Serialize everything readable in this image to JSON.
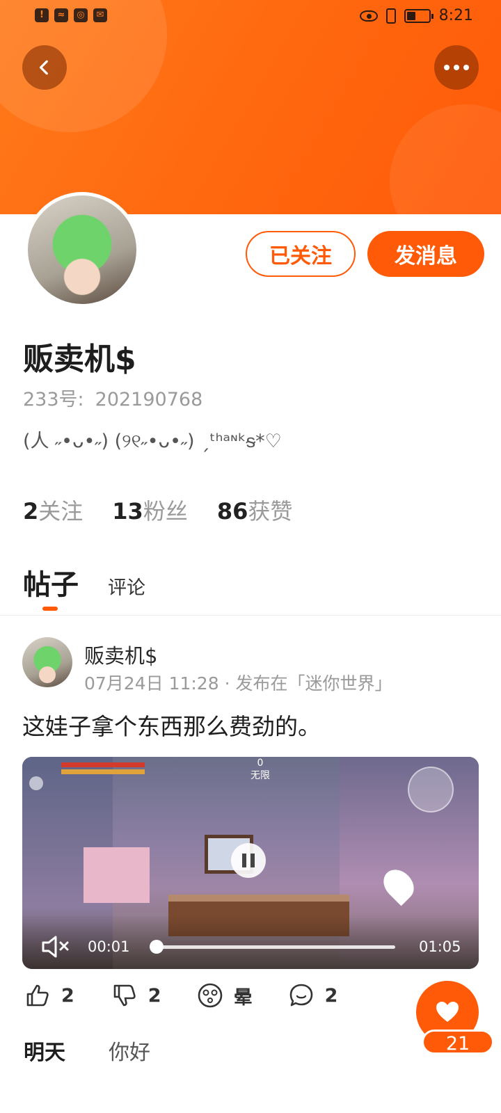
{
  "status_bar": {
    "time": "8:21",
    "icons": [
      "alert-icon",
      "wifi-icon",
      "globe-icon",
      "sms-icon",
      "eye-icon",
      "vibrate-icon",
      "battery-icon"
    ]
  },
  "profile": {
    "name": "贩卖机$",
    "id_label": "233号:",
    "id_value": "202190768",
    "bio": "(人 ˶•ᴗ•˶) (୨୧˶•ᴗ•˶) ˏᵗʰᵃᶰᵏᵴ*♡",
    "follow_state_label": "已关注",
    "message_label": "发消息"
  },
  "stats": [
    {
      "value": "2",
      "label": "关注"
    },
    {
      "value": "13",
      "label": "粉丝"
    },
    {
      "value": "86",
      "label": "获赞"
    }
  ],
  "tabs": {
    "posts": "帖子",
    "comments": "评论"
  },
  "post": {
    "author": "贩卖机$",
    "meta": "07月24日 11:28 · 发布在「迷你世界」",
    "text": "这娃子拿个东西那么费劲的。",
    "video": {
      "hud_top": "0",
      "hud_mode": "无限",
      "current_time": "00:01",
      "total_time": "01:05",
      "progress_fraction": 0.02
    },
    "actions": {
      "like_count": "2",
      "dislike_count": "2",
      "dizzy_label": "晕",
      "comment_count": "2"
    },
    "hot_comments": [
      "明天",
      "你好"
    ]
  },
  "fab": {
    "count": "21"
  },
  "colors": {
    "accent": "#ff5a08",
    "header_gradient_start": "#ff7a1a",
    "muted_text": "#9a9a9a"
  }
}
